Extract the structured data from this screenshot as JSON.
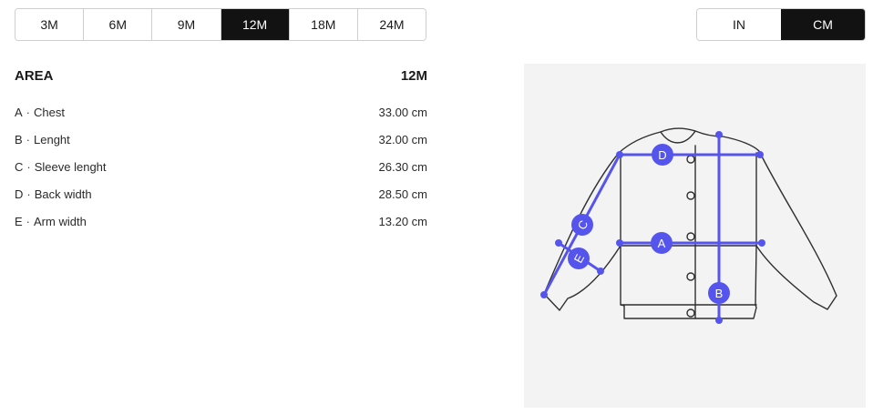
{
  "size_tabs": [
    {
      "label": "3M",
      "active": false
    },
    {
      "label": "6M",
      "active": false
    },
    {
      "label": "9M",
      "active": false
    },
    {
      "label": "12M",
      "active": true
    },
    {
      "label": "18M",
      "active": false
    },
    {
      "label": "24M",
      "active": false
    }
  ],
  "unit_tabs": [
    {
      "label": "IN",
      "active": false
    },
    {
      "label": "CM",
      "active": true
    }
  ],
  "table": {
    "header_area": "AREA",
    "header_size": "12M",
    "separator": "·",
    "rows": [
      {
        "letter": "A",
        "name": "Chest",
        "value": "33.00 cm"
      },
      {
        "letter": "B",
        "name": "Lenght",
        "value": "32.00 cm"
      },
      {
        "letter": "C",
        "name": "Sleeve lenght",
        "value": "26.30 cm"
      },
      {
        "letter": "D",
        "name": "Back width",
        "value": "28.50 cm"
      },
      {
        "letter": "E",
        "name": "Arm width",
        "value": "13.20 cm"
      }
    ]
  },
  "diagram": {
    "markers": [
      "A",
      "B",
      "C",
      "D",
      "E"
    ],
    "colors": {
      "measure": "#5555ee",
      "outline": "#2f2f2f",
      "background": "#f3f3f4",
      "active_tab": "#121212"
    }
  }
}
